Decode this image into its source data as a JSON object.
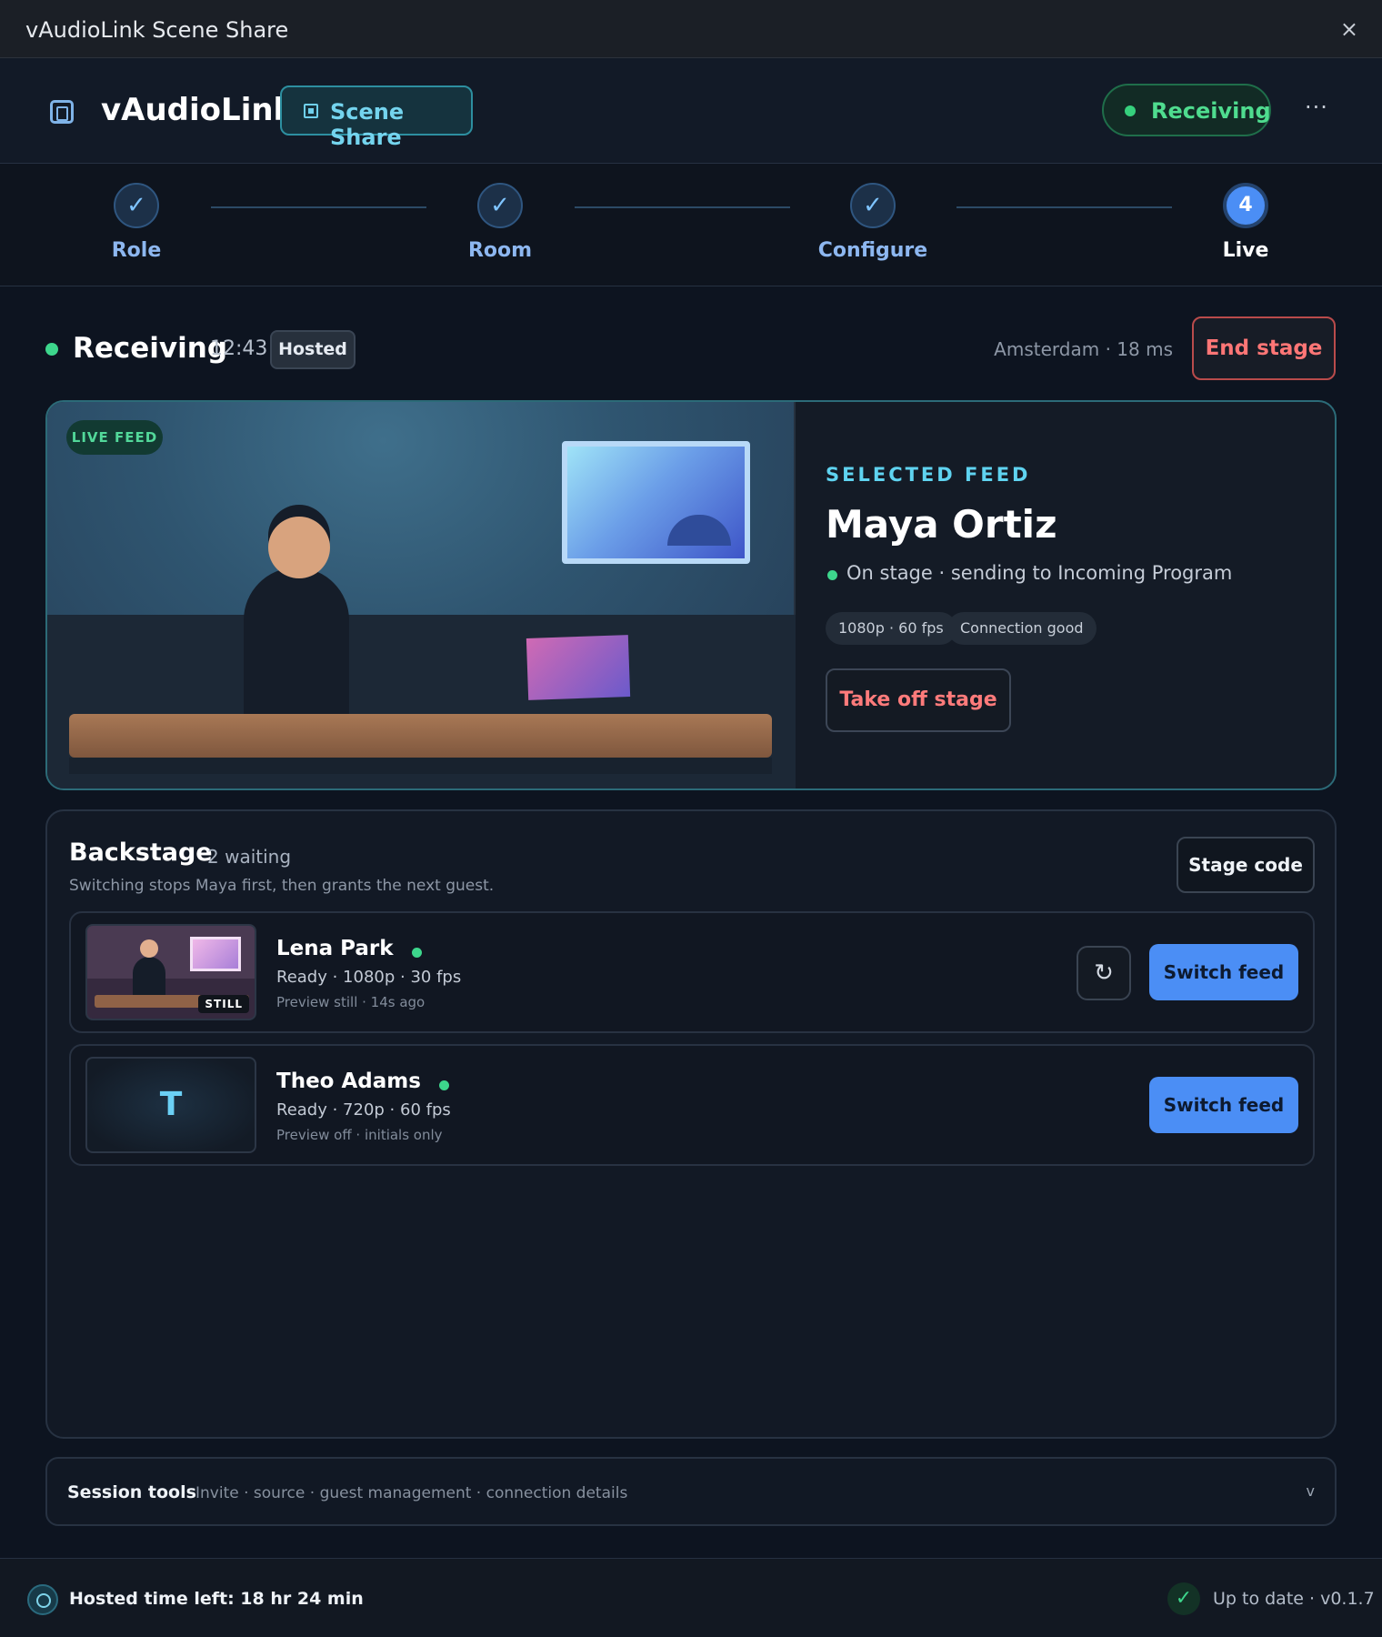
{
  "window": {
    "title": "vAudioLink Scene Share",
    "close_icon": "×"
  },
  "header": {
    "app_name": "vAudioLink",
    "mode_label": "Scene Share",
    "status_label": "Receiving",
    "more_icon": "···"
  },
  "stepper": {
    "steps": [
      {
        "label": "Role",
        "marker": "✓",
        "state": "done"
      },
      {
        "label": "Room",
        "marker": "✓",
        "state": "done"
      },
      {
        "label": "Configure",
        "marker": "✓",
        "state": "done"
      },
      {
        "label": "Live",
        "marker": "4",
        "state": "active"
      }
    ]
  },
  "stage": {
    "status": "Receiving",
    "elapsed": "12:43",
    "badge": "Hosted",
    "latency": "Amsterdam · 18 ms",
    "end_label": "End stage"
  },
  "selected_feed": {
    "badge": "LIVE FEED",
    "kicker": "SELECTED FEED",
    "name": "Maya Ortiz",
    "status": "On stage · sending to Incoming Program",
    "chips": [
      "1080p · 60 fps",
      "Connection good"
    ],
    "take_off_label": "Take off stage"
  },
  "backstage": {
    "title": "Backstage",
    "count": "2 waiting",
    "subtitle": "Switching stops Maya first, then grants the next guest.",
    "code_label": "Stage code",
    "guests": [
      {
        "name": "Lena Park",
        "meta": "Ready · 1080p · 30 fps",
        "preview": "Preview still · 14s ago",
        "thumb_badge": "STILL",
        "refresh_icon": "↻",
        "switch_label": "Switch feed"
      },
      {
        "name": "Theo Adams",
        "meta": "Ready · 720p · 60 fps",
        "preview": "Preview off · initials only",
        "initials": "T",
        "switch_label": "Switch feed"
      }
    ]
  },
  "session_tools": {
    "title": "Session tools",
    "description": "Invite · source · guest management · connection details",
    "chevron": "v"
  },
  "footer": {
    "hosted_time": "Hosted time left: 18 hr 24 min",
    "check_icon": "✓",
    "version": "Up to date · v0.1.7"
  },
  "colors": {
    "accent": "#4b8ef5",
    "live_green": "#3dd68c",
    "danger": "#ff7676",
    "cyan": "#5fd3f0"
  }
}
